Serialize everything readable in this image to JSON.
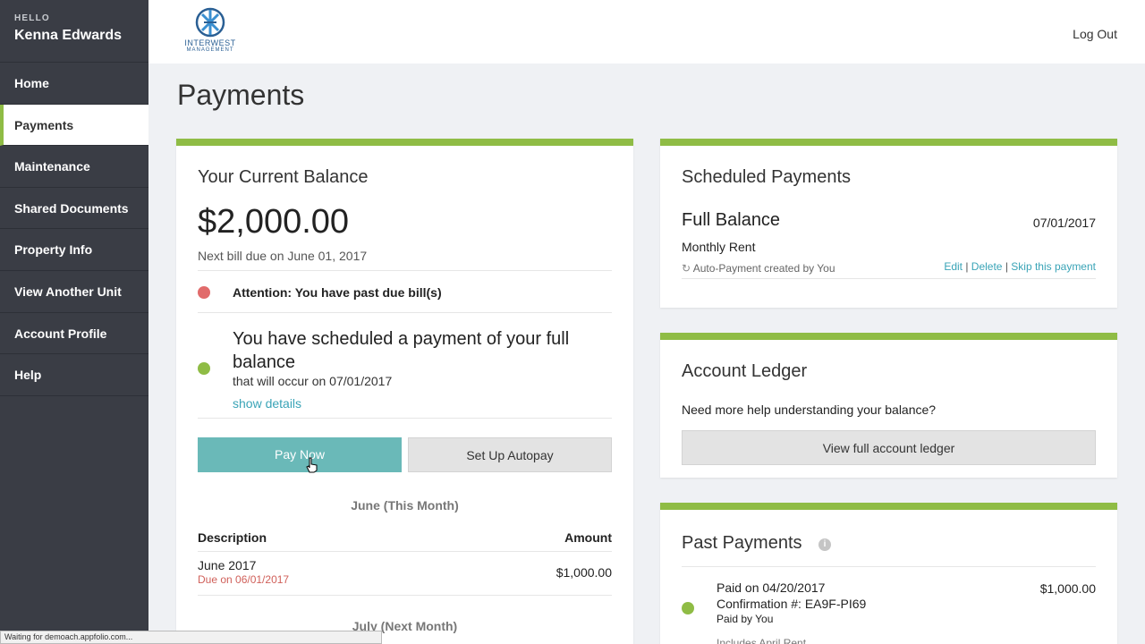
{
  "sidebar": {
    "hello": "HELLO",
    "user_name": "Kenna Edwards",
    "items": [
      {
        "label": "Home"
      },
      {
        "label": "Payments"
      },
      {
        "label": "Maintenance"
      },
      {
        "label": "Shared Documents"
      },
      {
        "label": "Property Info"
      },
      {
        "label": "View Another Unit"
      },
      {
        "label": "Account Profile"
      },
      {
        "label": "Help"
      }
    ],
    "active_index": 1
  },
  "header": {
    "logo_line1": "INTERWEST",
    "logo_line2": "MANAGEMENT",
    "logout_label": "Log Out"
  },
  "page": {
    "title": "Payments"
  },
  "balance": {
    "title": "Your Current Balance",
    "amount": "$2,000.00",
    "next_bill": "Next bill due on June 01, 2017",
    "attention": "Attention: You have past due bill(s)",
    "scheduled_headline": "You have scheduled a payment of your full balance",
    "scheduled_sub": "that will occur on 07/01/2017",
    "show_details": "show details",
    "pay_now": "Pay Now",
    "setup_autopay": "Set Up Autopay",
    "this_month_label": "June (This Month)",
    "col_description": "Description",
    "col_amount": "Amount",
    "rows": [
      {
        "description": "June 2017",
        "due": "Due on 06/01/2017",
        "amount": "$1,000.00"
      }
    ],
    "next_month_label": "July (Next Month)"
  },
  "scheduled": {
    "title": "Scheduled Payments",
    "item_title": "Full Balance",
    "item_sub": "Monthly Rent",
    "item_date": "07/01/2017",
    "auto_note": "Auto-Payment created by You",
    "edit": "Edit",
    "delete": "Delete",
    "skip": "Skip this payment"
  },
  "ledger": {
    "title": "Account Ledger",
    "help": "Need more help understanding your balance?",
    "button": "View full account ledger"
  },
  "past": {
    "title": "Past Payments",
    "paid_on": "Paid on 04/20/2017",
    "confirmation": "Confirmation #: EA9F-PI69",
    "paid_by": "Paid by You",
    "includes": "Includes April Rent",
    "amount": "$1,000.00"
  },
  "status_bar": "Waiting for demoach.appfolio.com...",
  "colors": {
    "accent_green": "#8fbc45",
    "pay_button": "#6ab9b8",
    "link": "#3aa4b7",
    "alert_red": "#e16b6b",
    "sidebar_bg": "#3a3d45"
  }
}
